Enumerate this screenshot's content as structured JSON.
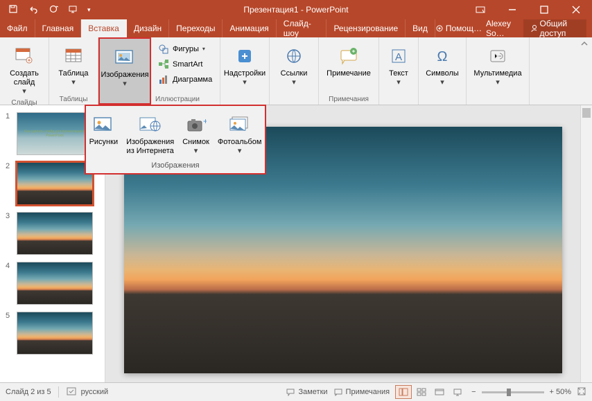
{
  "app": {
    "title": "Презентация1 - PowerPoint"
  },
  "tabs": [
    "Файл",
    "Главная",
    "Вставка",
    "Дизайн",
    "Переходы",
    "Анимация",
    "Слайд-шоу",
    "Рецензирование",
    "Вид"
  ],
  "active_tab_index": 2,
  "help": "Помощ…",
  "user": "Alexey So…",
  "share": "Общий доступ",
  "ribbon": {
    "newSlide": "Создать слайд",
    "slidesGroup": "Слайды",
    "table": "Таблица",
    "tablesGroup": "Таблицы",
    "images": "Изображения",
    "shapes": "Фигуры",
    "smartart": "SmartArt",
    "diagram": "Диаграмма",
    "illustrGroup": "Иллюстрации",
    "addins": "Надстройки",
    "links": "Ссылки",
    "comment": "Примечание",
    "commentGroup": "Примечания",
    "text": "Текст",
    "symbols": "Символы",
    "media": "Мультимедиа"
  },
  "dropdown": {
    "pictures": "Рисунки",
    "online": "Изображения из Интернета",
    "screenshot": "Снимок",
    "album": "Фотоальбом",
    "groupLabel": "Изображения"
  },
  "thumbs": {
    "slide1_text": "Как сделать слайд для презентации в PowerPoint",
    "numbers": [
      "1",
      "2",
      "3",
      "4",
      "5"
    ]
  },
  "status": {
    "slideInfo": "Слайд 2 из 5",
    "lang": "русский",
    "notes": "Заметки",
    "comments": "Примечания",
    "zoom": "+ 50%"
  }
}
